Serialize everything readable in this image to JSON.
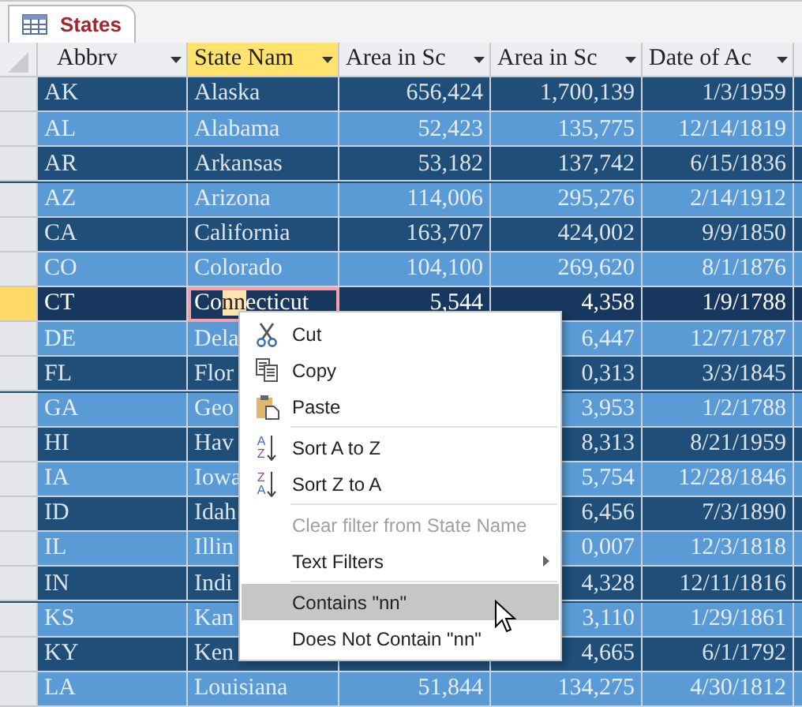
{
  "tab": {
    "title": "States",
    "selected": true
  },
  "columns": [
    {
      "label": "Abbrv",
      "selected": false
    },
    {
      "label": "State Nam",
      "selected": true
    },
    {
      "label": "Area in Sc",
      "selected": false
    },
    {
      "label": "Area in Sc",
      "selected": false
    },
    {
      "label": "Date of Ac",
      "selected": false
    }
  ],
  "rows": [
    {
      "current": false,
      "cells": [
        "AK",
        "Alaska",
        "656,424",
        "1,700,139",
        "1/3/1959"
      ]
    },
    {
      "current": false,
      "cells": [
        "AL",
        "Alabama",
        "52,423",
        "135,775",
        "12/14/1819"
      ]
    },
    {
      "current": false,
      "cells": [
        "AR",
        "Arkansas",
        "53,182",
        "137,742",
        "6/15/1836"
      ]
    },
    {
      "current": false,
      "cells": [
        "AZ",
        "Arizona",
        "114,006",
        "295,276",
        "2/14/1912"
      ]
    },
    {
      "current": false,
      "cells": [
        "CA",
        "California",
        "163,707",
        "424,002",
        "9/9/1850"
      ]
    },
    {
      "current": false,
      "cells": [
        "CO",
        "Colorado",
        "104,100",
        "269,620",
        "8/1/1876"
      ]
    },
    {
      "current": true,
      "cells": [
        "CT",
        {
          "parts": [
            {
              "text": "Co",
              "selected": false
            },
            {
              "text": "nn",
              "selected": true
            },
            {
              "text": "ecticut",
              "selected": false
            }
          ]
        },
        "5,544",
        "4,358",
        "1/9/1788"
      ]
    },
    {
      "current": false,
      "cells": [
        "DE",
        "Dela",
        null,
        "6,447",
        "12/7/1787"
      ]
    },
    {
      "current": false,
      "cells": [
        "FL",
        "Flor",
        null,
        "0,313",
        "3/3/1845"
      ]
    },
    {
      "current": false,
      "cells": [
        "GA",
        "Geo",
        null,
        "3,953",
        "1/2/1788"
      ]
    },
    {
      "current": false,
      "cells": [
        "HI",
        "Hav",
        null,
        "8,313",
        "8/21/1959"
      ]
    },
    {
      "current": false,
      "cells": [
        "IA",
        "Iowa",
        null,
        "5,754",
        "12/28/1846"
      ]
    },
    {
      "current": false,
      "cells": [
        "ID",
        "Idah",
        null,
        "6,456",
        "7/3/1890"
      ]
    },
    {
      "current": false,
      "cells": [
        "IL",
        "Illin",
        null,
        "0,007",
        "12/3/1818"
      ]
    },
    {
      "current": false,
      "cells": [
        "IN",
        "Indi",
        null,
        "4,328",
        "12/11/1816"
      ]
    },
    {
      "current": false,
      "cells": [
        "KS",
        "Kan",
        null,
        "3,110",
        "1/29/1861"
      ]
    },
    {
      "current": false,
      "cells": [
        "KY",
        "Ken",
        null,
        "4,665",
        "6/1/1792"
      ]
    },
    {
      "current": false,
      "cells": [
        "LA",
        "Louisiana",
        "51,844",
        "134,275",
        "4/30/1812"
      ]
    }
  ],
  "context_menu": {
    "items": [
      {
        "kind": "cut",
        "label": "Cut",
        "disabled": false,
        "highlighted": false
      },
      {
        "kind": "copy",
        "label": "Copy",
        "disabled": false,
        "highlighted": false
      },
      {
        "kind": "paste",
        "label": "Paste",
        "disabled": false,
        "highlighted": false
      },
      {
        "kind": "separator"
      },
      {
        "kind": "sortasc",
        "label": "Sort A to Z",
        "icon_letters": [
          "A",
          "Z"
        ],
        "disabled": false,
        "highlighted": false
      },
      {
        "kind": "sortdesc",
        "label": "Sort Z to A",
        "icon_letters": [
          "Z",
          "A"
        ],
        "disabled": false,
        "highlighted": false
      },
      {
        "kind": "separator"
      },
      {
        "kind": "plain",
        "label": "Clear filter from State Name",
        "disabled": true,
        "highlighted": false
      },
      {
        "kind": "submenu",
        "label": "Text Filters",
        "disabled": false,
        "highlighted": false
      },
      {
        "kind": "separator"
      },
      {
        "kind": "plain",
        "label": "Contains \"nn\"",
        "disabled": false,
        "highlighted": true
      },
      {
        "kind": "plain",
        "label": "Does Not Contain \"nn\"",
        "disabled": false,
        "highlighted": false
      }
    ]
  }
}
